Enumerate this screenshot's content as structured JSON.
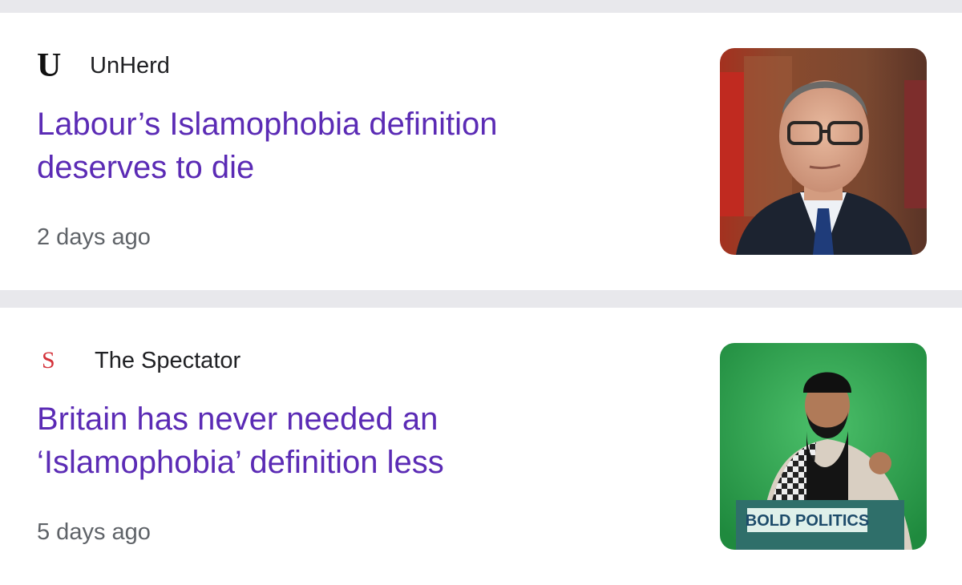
{
  "articles": [
    {
      "source_name": "UnHerd",
      "source_logo": "U",
      "source_logo_color": "#111111",
      "headline_line1": "Labour’s Islamophobia definition",
      "headline_line2": "deserves to die",
      "time_ago": "2 days ago",
      "headline_color": "#5b2bb5"
    },
    {
      "source_name": "The Spectator",
      "source_logo": "S",
      "source_logo_color": "#d4323a",
      "headline_line1": "Britain has never needed an",
      "headline_line2": "‘Islamophobia’ definition less",
      "time_ago": "5 days ago",
      "thumbnail_sign_text": "BOLD POLITICS",
      "headline_color": "#5b2bb5"
    }
  ]
}
